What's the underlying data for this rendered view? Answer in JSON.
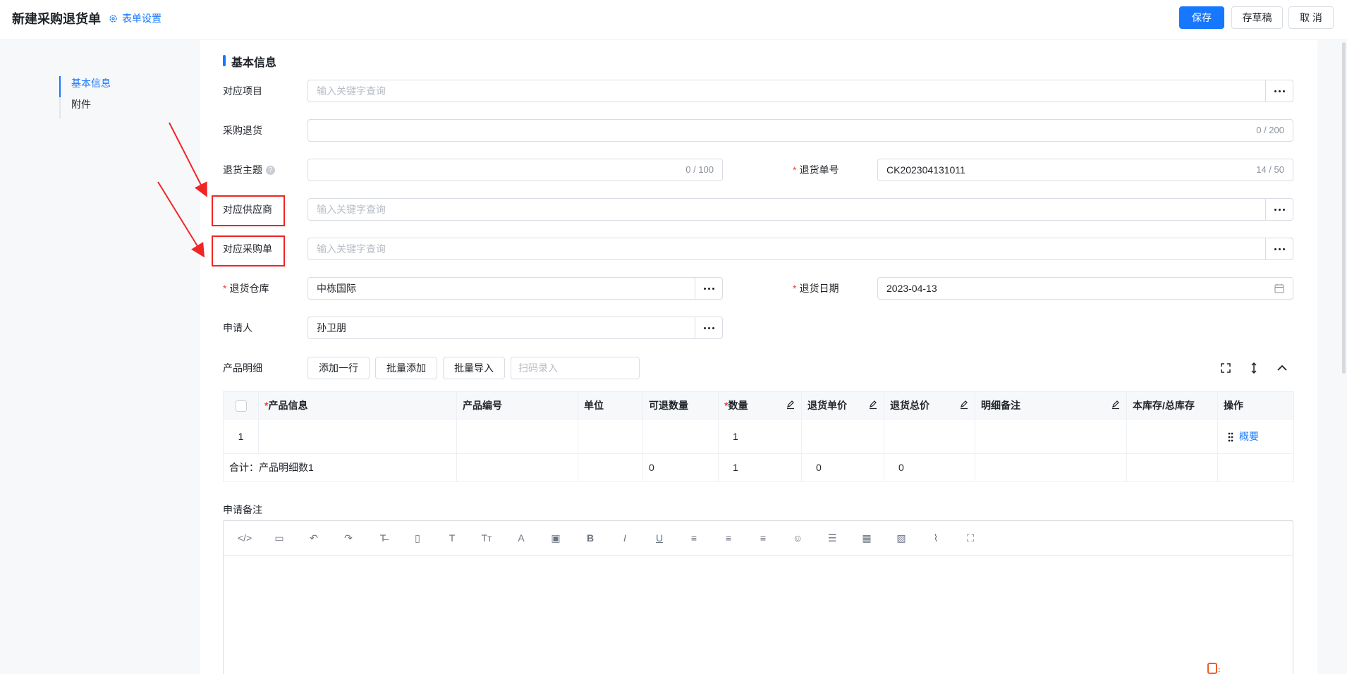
{
  "header": {
    "title": "新建采购退货单",
    "form_settings": "表单设置",
    "save": "保存",
    "draft": "存草稿",
    "cancel": "取 消"
  },
  "anchor_nav": [
    "基本信息",
    "附件"
  ],
  "section": {
    "title": "基本信息"
  },
  "fields": {
    "project": {
      "label": "对应项目",
      "placeholder": "输入关键字查询"
    },
    "purchase_return": {
      "label": "采购退货",
      "count": "0 / 200"
    },
    "subject": {
      "label": "退货主题",
      "count": "0 / 100"
    },
    "return_no": {
      "label": "退货单号",
      "value": "CK202304131011",
      "count": "14 / 50"
    },
    "supplier": {
      "label": "对应供应商",
      "placeholder": "输入关键字查询"
    },
    "purchase_order": {
      "label": "对应采购单",
      "placeholder": "输入关键字查询"
    },
    "warehouse": {
      "label": "退货仓库",
      "value": "中栋国际"
    },
    "return_date": {
      "label": "退货日期",
      "value": "2023-04-13"
    },
    "applicant": {
      "label": "申请人",
      "value": "孙卫朋"
    }
  },
  "products": {
    "label": "产品明细",
    "add_row": "添加一行",
    "batch_add": "批量添加",
    "batch_import": "批量导入",
    "scan_placeholder": "扫码录入",
    "columns": [
      "产品信息",
      "产品编号",
      "单位",
      "可退数量",
      "数量",
      "退货单价",
      "退货总价",
      "明细备注",
      "本库存/总库存",
      "操作"
    ],
    "rows": [
      {
        "index": "1",
        "product": "",
        "code": "",
        "unit": "",
        "returnable": "",
        "qty": "1",
        "price": "",
        "total": "",
        "remark": "",
        "stock": "",
        "action": "概要"
      }
    ],
    "summary": {
      "label": "合计：产品明细数1",
      "returnable": "0",
      "qty": "1",
      "price": "0",
      "total": "0"
    }
  },
  "remark": {
    "label": "申请备注"
  },
  "colors": {
    "primary": "#1677ff",
    "required": "#f53f3f",
    "annotation": "#f02525"
  }
}
